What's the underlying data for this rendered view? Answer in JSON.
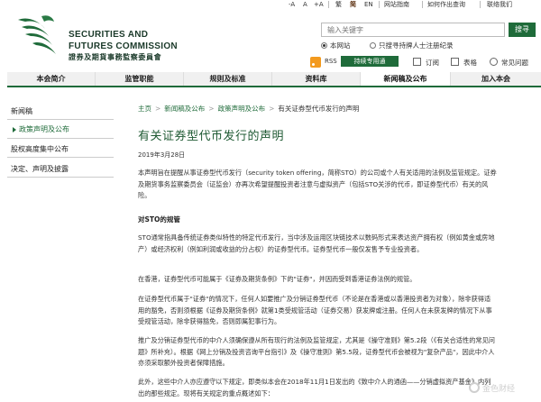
{
  "top_utility": {
    "items": [
      "-A",
      "A",
      "+A",
      "繁",
      "简",
      "EN",
      "网站指南",
      "如何作出查询",
      "联络我们"
    ],
    "active_index": 4
  },
  "header": {
    "org_name_en_line1": "SECURITIES AND",
    "org_name_en_line2": "FUTURES COMMISSION",
    "org_name_zh": "證券及期貨事務監察委員會"
  },
  "search": {
    "placeholder": "输入关键字",
    "button_label": "搜寻",
    "option_site": "本网站",
    "option_registry": "只搜寻持牌人士注册纪录"
  },
  "utility_links": {
    "rss": "RSS",
    "mobile": "持续专用通",
    "subscribe": "订阅",
    "forms": "表格",
    "faq": "常见问题"
  },
  "main_nav": [
    {
      "label": "本会简介"
    },
    {
      "label": "监管职能"
    },
    {
      "label": "规则及标准"
    },
    {
      "label": "资料库"
    },
    {
      "label": "新闻稿及公布",
      "active": true
    },
    {
      "label": "加入本会"
    }
  ],
  "sidebar": {
    "items": [
      {
        "label": "新闻稿"
      },
      {
        "label": "政策声明及公布",
        "active": true
      },
      {
        "label": "股权高度集中公布"
      },
      {
        "label": "决定、声明及披露"
      }
    ]
  },
  "breadcrumb": [
    "主页",
    "新闻稿及公布",
    "政策声明及公布",
    "有关证券型代币发行的声明"
  ],
  "article": {
    "title": "有关证券型代币发行的声明",
    "date": "2019年3月28日",
    "paragraphs": [
      "本声明旨在提醒从事证券型代币发行（security token offering，简称STO）的公司或个人有关适用的法例及监管规定。证券及期货事务监察委员会（证监会）亦再次希望提醒投资者注意与虚拟资产（包括STO关涉的代币，即证券型代币）有关的风险。",
      "对STO的规管",
      "STO通常指具备传统证券类似特性的特定代币发行，当中涉及运用区块链技术以数码形式来表达资产拥有权（例如黄金或房地产）或经济权利（例如利润或收益的分占权）的证券型代币。证券型代币一般仅发售予专业投资者。",
      "在香港，证券型代币可能属于《证券及期货条例》下的\"证券\"，并因而受到香港证券法例的规管。",
      "在证券型代币属于\"证券\"的情况下，任何人如要推广及分销证券型代币（不论是在香港或以香港投资者为对象），除非获得适用的豁免，否则须根据《证券及期货条例》就第1类受规管活动（证券交易）获发牌或注册。任何人在未获发牌的情况下从事受规管活动，除非获得豁免，否则即属犯事行为。",
      "推广及分销证券型代币的中介人须确保遵从所有现行的法例及监管规定，尤其是《操守准则》第5.2段（《有关合适性的常见问题》所补充）。根据《网上分销及投资咨询平台指引》及《操守准则》第5.5段，证券型代币会被视为\"复杂产品\"，因此中介人亦须采取额外投资者保障措施。",
      "此外，这些中介人亦应遵守以下规定，即类似本会在2018年11月1日发出的《致中介人的通函——分销虚拟资产基金》内列出的那些规定。现将有关规定的重点概述如下："
    ]
  },
  "watermark": "金色财经"
}
